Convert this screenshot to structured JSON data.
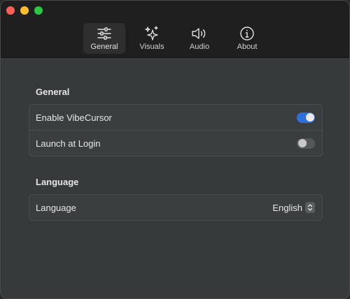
{
  "toolbar": {
    "tabs": [
      {
        "label": "General",
        "icon": "sliders-icon",
        "selected": true
      },
      {
        "label": "Visuals",
        "icon": "sparkles-icon",
        "selected": false
      },
      {
        "label": "Audio",
        "icon": "speaker-icon",
        "selected": false
      },
      {
        "label": "About",
        "icon": "info-circle-icon",
        "selected": false
      }
    ]
  },
  "general": {
    "title": "General",
    "rows": [
      {
        "label": "Enable VibeCursor",
        "control": "toggle",
        "on": true
      },
      {
        "label": "Launch at Login",
        "control": "toggle",
        "on": false
      }
    ]
  },
  "language": {
    "title": "Language",
    "row": {
      "label": "Language",
      "value": "English"
    }
  },
  "colors": {
    "accent": "#2e6fdc",
    "close": "#fe5f57",
    "minimize": "#febc2e",
    "zoom": "#28c840"
  }
}
